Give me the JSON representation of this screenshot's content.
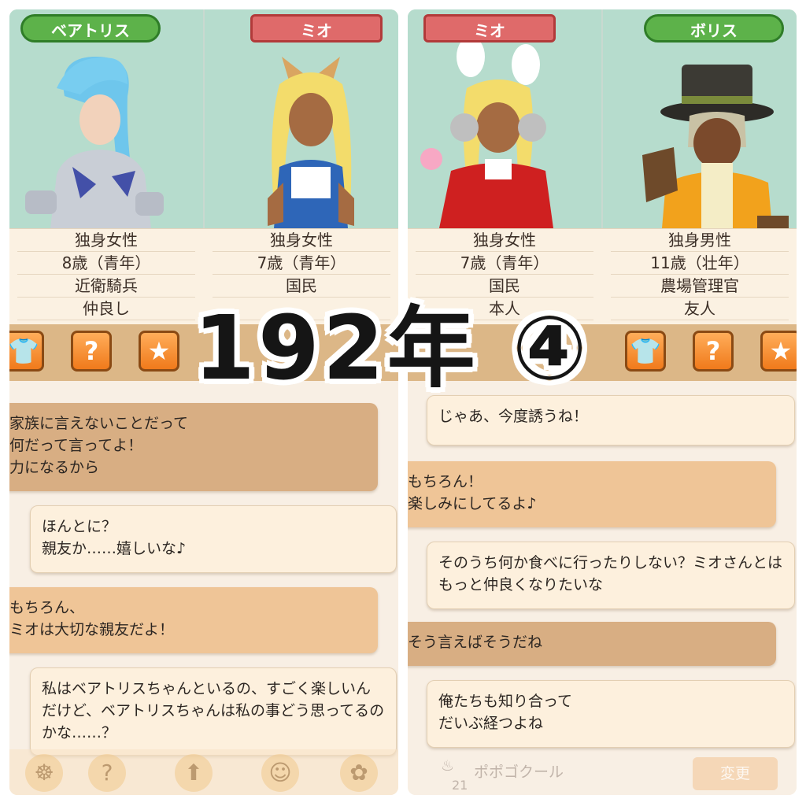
{
  "left_panel": {
    "characters": [
      {
        "name": "ベアトリス",
        "tag_color": "green",
        "info": [
          "独身女性",
          "8歳（青年）",
          "近衛騎兵",
          "仲良し"
        ]
      },
      {
        "name": "ミオ",
        "tag_color": "red",
        "info": [
          "独身女性",
          "7歳（青年）",
          "国民",
          ""
        ]
      }
    ],
    "toolbar": [
      "clothes-icon",
      "question-icon",
      "star-icon"
    ],
    "messages": [
      {
        "text": "家族に言えないことだって\n何だって言ってよ！\n力になるから",
        "side": "other"
      },
      {
        "text": "ほんとに？\n親友か……嬉しいな♪",
        "side": "self"
      },
      {
        "text": "もちろん、\nミオは大切な親友だよ！",
        "side": "other"
      },
      {
        "text": "私はベアトリスちゃんといるの、すごく楽しいんだけど、ベアトリスちゃんは私の事どう思ってるのかな……？",
        "side": "self"
      }
    ]
  },
  "right_panel": {
    "characters": [
      {
        "name": "ミオ",
        "tag_color": "red",
        "info": [
          "独身女性",
          "7歳（青年）",
          "国民",
          "本人"
        ]
      },
      {
        "name": "ボリス",
        "tag_color": "green",
        "info": [
          "独身男性",
          "11歳（壮年）",
          "農場管理官",
          "友人"
        ]
      }
    ],
    "toolbar": [
      "clothes-icon",
      "question-icon",
      "star-icon"
    ],
    "messages": [
      {
        "text": "じゃあ、今度誘うね！",
        "side": "self"
      },
      {
        "text": "もちろん！\n楽しみにしてるよ♪",
        "side": "other"
      },
      {
        "text": "そのうち何か食べに行ったりしない？ミオさんとはもっと仲良くなりたいな",
        "side": "self"
      },
      {
        "text": "そう言えばそうだね",
        "side": "dark"
      },
      {
        "text": "俺たちも知り合って\nだいぶ経つよね",
        "side": "self"
      }
    ],
    "footer": {
      "item": "ポポゴクール",
      "count": "21",
      "button": "変更"
    }
  },
  "overlay": {
    "title": "192年 ④"
  },
  "colors": {
    "tag_green": "#5db24a",
    "tag_red": "#df6a6a",
    "toolbar_bg": "#dcb787",
    "portrait_bg": "#b6dccd"
  }
}
